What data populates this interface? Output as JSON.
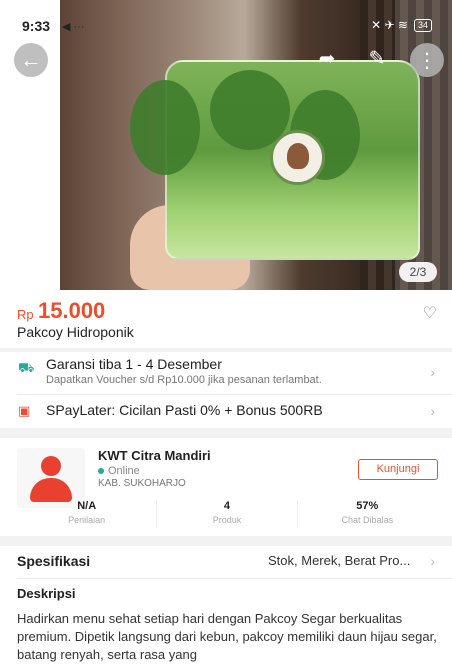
{
  "status_bar": {
    "time": "9:33",
    "nav_glyphs": "◀ ···",
    "icon_glyphs": "✕ ✈ ≋",
    "battery": "34"
  },
  "gallery": {
    "counter": "2/3"
  },
  "top_actions": {
    "back_icon": "arrow-left-icon",
    "share_icon": "share-icon",
    "edit_icon": "edit-icon",
    "more_icon": "more-icon"
  },
  "product": {
    "currency": "Rp",
    "price": "15.000",
    "name": "Pakcoy Hidroponik"
  },
  "shipping": {
    "title": "Garansi tiba 1 - 4 Desember",
    "subtitle": "Dapatkan Voucher s/d Rp10.000 jika pesanan terlambat."
  },
  "paylater": {
    "title": "SPayLater: Cicilan Pasti 0% + Bonus 500RB"
  },
  "shop": {
    "name": "KWT Citra Mandiri",
    "status": "Online",
    "location": "KAB. SUKOHARJO",
    "visit_label": "Kunjungi",
    "stats": [
      {
        "value": "N/A",
        "label": "Penilaian"
      },
      {
        "value": "4",
        "label": "Produk"
      },
      {
        "value": "57%",
        "label": "Chat Dibalas"
      }
    ]
  },
  "specs": {
    "title": "Spesifikasi",
    "summary": "Stok, Merek, Berat Pro..."
  },
  "description": {
    "title": "Deskripsi",
    "text": "Hadirkan menu sehat setiap hari dengan Pakcoy Segar berkualitas premium. Dipetik langsung dari kebun, pakcoy memiliki daun hijau segar, batang renyah, serta rasa yang"
  },
  "colors": {
    "brand": "#ee4d2d",
    "teal": "#26aa99"
  }
}
